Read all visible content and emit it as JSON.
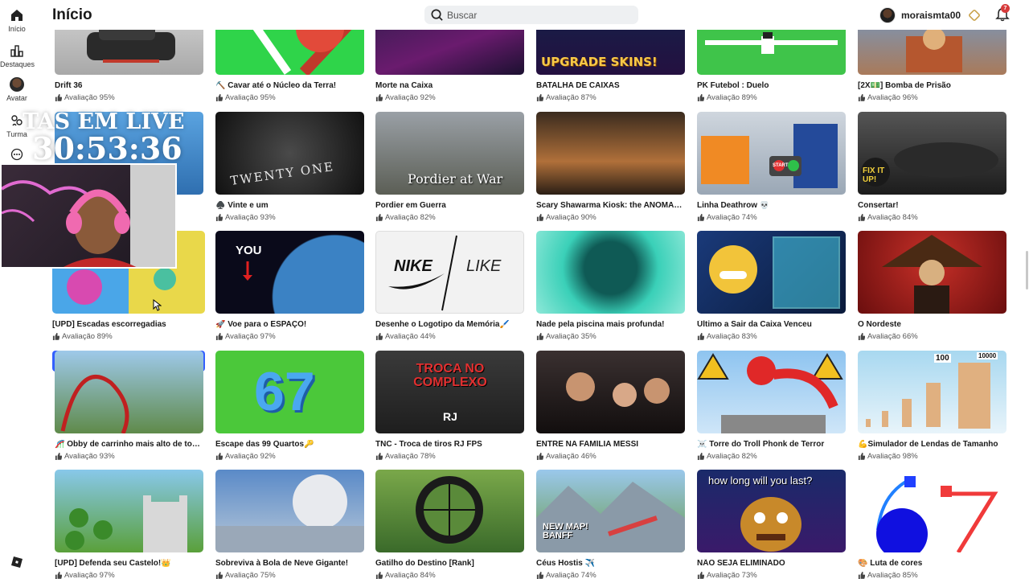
{
  "header": {
    "title": "Início",
    "search_placeholder": "Buscar",
    "username": "moraismta00",
    "notification_count": "7"
  },
  "sidebar": {
    "items": [
      {
        "label": "Início",
        "icon": "home-icon"
      },
      {
        "label": "Destaques",
        "icon": "charts-icon"
      },
      {
        "label": "Avatar",
        "icon": "avatar-icon"
      },
      {
        "label": "Turma",
        "icon": "party-icon"
      },
      {
        "label": "",
        "icon": "more-icon"
      }
    ]
  },
  "overlay": {
    "stream_text": "TAS EM LIVE",
    "timer": "30:53:36"
  },
  "rows": [
    [
      {
        "title": "Drift 36",
        "rating": "Avaliação 95%"
      },
      {
        "title": "⛏️ Cavar até o Núcleo da Terra!",
        "rating": "Avaliação 95%"
      },
      {
        "title": "Morte na Caixa",
        "rating": "Avaliação 92%"
      },
      {
        "title": "BATALHA DE CAIXAS",
        "rating": "Avaliação 87%"
      },
      {
        "title": "PK Futebol : Duelo",
        "rating": "Avaliação 89%"
      },
      {
        "title": "[2X💵] Bomba de Prisão",
        "rating": "Avaliação 96%"
      }
    ],
    [
      {
        "title": "",
        "rating": ""
      },
      {
        "title": "♠️ Vinte e um",
        "rating": "Avaliação 93%"
      },
      {
        "title": "Pordier em Guerra",
        "rating": "Avaliação 82%"
      },
      {
        "title": "Scary Shawarma Kiosk: the ANOMALY ...",
        "rating": "Avaliação 90%"
      },
      {
        "title": "Linha Deathrow 💀",
        "rating": "Avaliação 74%"
      },
      {
        "title": "Consertar!",
        "rating": "Avaliação 84%"
      }
    ],
    [
      {
        "title": "[UPD] Escadas escorregadias",
        "rating": "Avaliação 89%"
      },
      {
        "title": "🚀 Voe para o ESPAÇO!",
        "rating": "Avaliação 97%"
      },
      {
        "title": "Desenhe o Logotipo da Memória🖌️",
        "rating": "Avaliação 44%"
      },
      {
        "title": "Nade pela piscina mais profunda!",
        "rating": "Avaliação 35%"
      },
      {
        "title": "Último a Sair da Caixa Venceu",
        "rating": "Avaliação 83%"
      },
      {
        "title": "O Nordeste",
        "rating": "Avaliação 66%"
      }
    ],
    [
      {
        "title": "🎢 Obby de carrinho mais alto de todo...",
        "rating": "Avaliação 93%"
      },
      {
        "title": "Escape das 99 Quartos🔑",
        "rating": "Avaliação 92%"
      },
      {
        "title": "TNC - Troca de tiros RJ FPS",
        "rating": "Avaliação 78%"
      },
      {
        "title": "ENTRE NA FAMÍLIA MESSI",
        "rating": "Avaliação 46%"
      },
      {
        "title": "☠️ Torre do Troll Phonk de Terror",
        "rating": "Avaliação 82%"
      },
      {
        "title": "💪Simulador de Lendas de Tamanho",
        "rating": "Avaliação 98%"
      }
    ],
    [
      {
        "title": "[UPD] Defenda seu Castelo!👑",
        "rating": "Avaliação 97%"
      },
      {
        "title": "Sobreviva à Bola de Neve Gigante!",
        "rating": "Avaliação 75%"
      },
      {
        "title": "Gatilho do Destino [Rank]",
        "rating": "Avaliação 84%"
      },
      {
        "title": "Céus Hostis ✈️",
        "rating": "Avaliação 74%"
      },
      {
        "title": "NÃO SEJA ELIMINADO",
        "rating": "Avaliação 73%"
      },
      {
        "title": "🎨 Luta de cores",
        "rating": "Avaliação 85%"
      }
    ]
  ],
  "thumb_texts": {
    "upgrade": "UPGRADE SKINS!",
    "twentyone": "TWENTY ONE",
    "pordier": "Pordier at War",
    "fixit": "FIX IT UP!",
    "you": "YOU",
    "nike": "NIKE",
    "like": "LIKE",
    "sixtyseven": "67",
    "troca": "TROCA NO COMPLEXO",
    "rj": "RJ",
    "howlong": "how long will you last?",
    "newmap": "NEW MAP! BANFF",
    "start": "START",
    "num100": "100",
    "num10000": "10000"
  },
  "colors": {
    "play_button": "#335fff",
    "badge": "#d63a3a"
  }
}
